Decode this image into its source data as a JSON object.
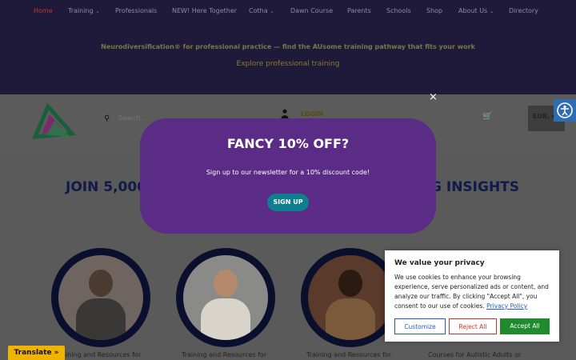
{
  "nav": {
    "items": [
      {
        "label": "Home",
        "active": true,
        "dropdown": false
      },
      {
        "label": "Training",
        "active": false,
        "dropdown": true
      },
      {
        "label": "Professionals",
        "active": false,
        "dropdown": false
      },
      {
        "label": "NEW! Here Together",
        "active": false,
        "dropdown": false
      },
      {
        "label": "Cotha",
        "active": false,
        "dropdown": true
      },
      {
        "label": "Dawn Course",
        "active": false,
        "dropdown": false
      },
      {
        "label": "Parents",
        "active": false,
        "dropdown": false
      },
      {
        "label": "Schools",
        "active": false,
        "dropdown": false
      },
      {
        "label": "Shop",
        "active": false,
        "dropdown": false
      },
      {
        "label": "About Us",
        "active": false,
        "dropdown": true
      },
      {
        "label": "Directory",
        "active": false,
        "dropdown": false
      }
    ],
    "chevron": "⌄"
  },
  "promo": {
    "text": "Neurodiversification® for professional practice — find the AUsome training pathway that fits your work",
    "link": "Explore professional training"
  },
  "header": {
    "search_placeholder": "Search...",
    "login_label": "LOGIN",
    "currency_label": "EUR, €",
    "icons": {
      "search": "search-icon",
      "user": "user-icon",
      "cart": "cart-icon",
      "accessibility": "accessibility-icon"
    }
  },
  "content": {
    "heading_left": "JOIN 5,000",
    "heading_right": "G INSIGHTS",
    "cards": [
      {
        "caption": "Training and Resources for"
      },
      {
        "caption": "Training and Resources for"
      },
      {
        "caption": "Training and Resources for"
      },
      {
        "caption": "Courses for Autistic Adults or"
      }
    ]
  },
  "modal": {
    "title": "FANCY 10% OFF?",
    "text": "Sign up to our newsletter for a 10% discount code!",
    "button": "SIGN UP",
    "close": "×"
  },
  "cookie": {
    "title": "We value your privacy",
    "text": "We use cookies to enhance your browsing experience, serve personalized ads or content, and analyze our traffic. By clicking \"Accept All\", you consent to our use of cookies.",
    "link": "Privacy Policy",
    "customize": "Customize",
    "reject": "Reject All",
    "accept": "Accept All"
  },
  "translate": {
    "label": "Translate »"
  },
  "colors": {
    "modal": "#5b2c86",
    "signup": "#0f7f8f",
    "accept": "#1f8a2e",
    "reject": "#c0392b",
    "customize": "#1f5dbf",
    "translate": "#f0b400"
  }
}
